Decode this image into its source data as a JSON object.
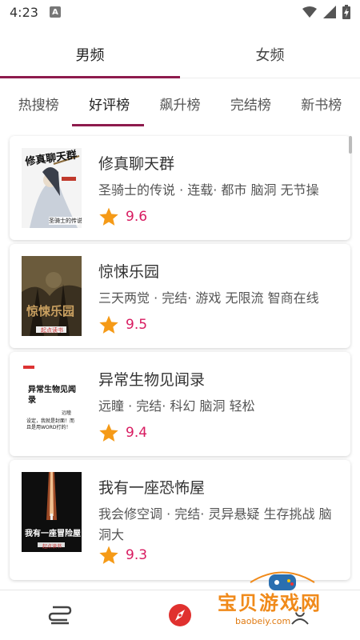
{
  "status_bar": {
    "time": "4:23",
    "a_badge": "A"
  },
  "gender_tabs": [
    {
      "label": "男频",
      "active": true
    },
    {
      "label": "女频",
      "active": false
    }
  ],
  "rank_tabs": [
    {
      "label": "热搜榜",
      "active": false
    },
    {
      "label": "好评榜",
      "active": true
    },
    {
      "label": "飙升榜",
      "active": false
    },
    {
      "label": "完结榜",
      "active": false
    },
    {
      "label": "新书榜",
      "active": false
    }
  ],
  "books": [
    {
      "title": "修真聊天群",
      "meta": "圣骑士的传说 · 连载· 都市 脑洞 无节操",
      "rating": "9.6",
      "cover": {
        "title_text": "修真聊天群",
        "author_text": "圣骑士的传说",
        "publisher": "起点读书",
        "colors": [
          "#f3f3f3",
          "#9aa8b8"
        ]
      }
    },
    {
      "title": "惊悚乐园",
      "meta": "三天两觉 · 完结· 游戏 无限流 智商在线",
      "rating": "9.5",
      "cover": {
        "title_text": "惊悚乐园",
        "publisher": "起点读书",
        "colors": [
          "#5a4a30",
          "#2c2418"
        ]
      }
    },
    {
      "title": "异常生物见闻录",
      "meta": "远瞳 · 完结· 科幻 脑洞 轻松",
      "rating": "9.4",
      "cover": {
        "title_text": "异常生物见闻录",
        "author_text": "远瞳",
        "tagline": "设定，我就是封面！而且是用WORD打的！",
        "colors": [
          "#ffffff",
          "#222222"
        ]
      }
    },
    {
      "title": "我有一座恐怖屋",
      "meta": "我会修空调 · 完结· 灵异悬疑 生存挑战 脑洞大",
      "rating": "9.3",
      "cover": {
        "title_text": "我有一座冒险屋",
        "publisher": "起点读书",
        "colors": [
          "#101010",
          "#b04020"
        ]
      }
    }
  ],
  "watermark": {
    "text": "宝贝游戏网",
    "url": "baobeiy.com"
  }
}
